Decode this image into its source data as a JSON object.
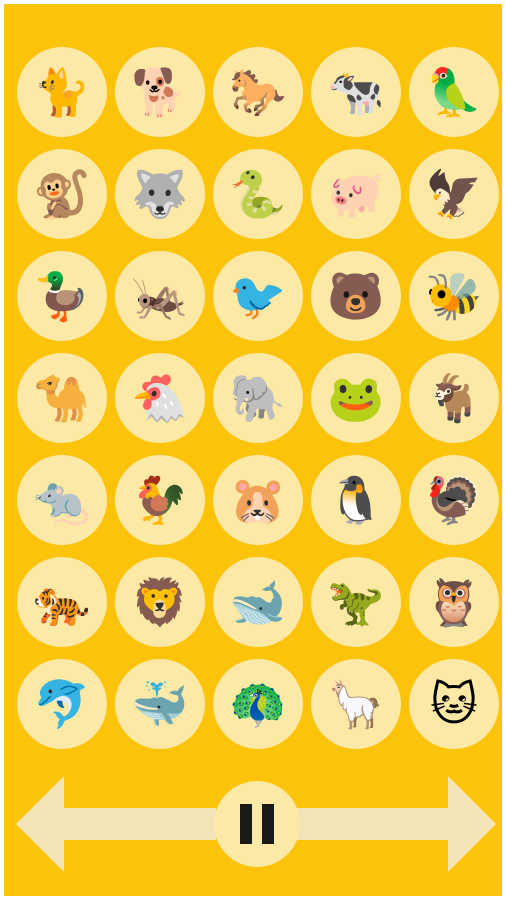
{
  "theme": {
    "background": "#fbc30a",
    "tile": "#fde9a6",
    "arrow": "#f3e4b8",
    "pause_bars": "#1a1a1a"
  },
  "animals": [
    {
      "name": "cat",
      "glyph": "🐈"
    },
    {
      "name": "dog",
      "glyph": "🐕"
    },
    {
      "name": "horse",
      "glyph": "🐎"
    },
    {
      "name": "cow",
      "glyph": "🐄"
    },
    {
      "name": "parrot",
      "glyph": "🦜"
    },
    {
      "name": "monkey",
      "glyph": "🐒"
    },
    {
      "name": "wolf",
      "glyph": "🐺"
    },
    {
      "name": "snake",
      "glyph": "🐍"
    },
    {
      "name": "pig",
      "glyph": "🐖"
    },
    {
      "name": "eagle",
      "glyph": "🦅"
    },
    {
      "name": "duck",
      "glyph": "🦆"
    },
    {
      "name": "cricket",
      "glyph": "🦗"
    },
    {
      "name": "cardinal",
      "glyph": "🐦"
    },
    {
      "name": "bear",
      "glyph": "🐻"
    },
    {
      "name": "bee",
      "glyph": "🐝"
    },
    {
      "name": "camel",
      "glyph": "🐪"
    },
    {
      "name": "chicken",
      "glyph": "🐔"
    },
    {
      "name": "elephant",
      "glyph": "🐘"
    },
    {
      "name": "frog",
      "glyph": "🐸"
    },
    {
      "name": "goat",
      "glyph": "🐐"
    },
    {
      "name": "rat",
      "glyph": "🐀"
    },
    {
      "name": "rooster",
      "glyph": "🐓"
    },
    {
      "name": "hamster",
      "glyph": "🐹"
    },
    {
      "name": "penguin",
      "glyph": "🐧"
    },
    {
      "name": "turkey",
      "glyph": "🦃"
    },
    {
      "name": "tiger",
      "glyph": "🐅"
    },
    {
      "name": "lion",
      "glyph": "🦁"
    },
    {
      "name": "whale",
      "glyph": "🐋"
    },
    {
      "name": "dinosaur",
      "glyph": "🦖"
    },
    {
      "name": "owl",
      "glyph": "🦉"
    },
    {
      "name": "dolphin",
      "glyph": "🐬"
    },
    {
      "name": "spouting-whale",
      "glyph": "🐳"
    },
    {
      "name": "peacock",
      "glyph": "🦚"
    },
    {
      "name": "llama",
      "glyph": "🦙"
    },
    {
      "name": "cat-face",
      "glyph": "🐱"
    }
  ],
  "controls": {
    "prev": "previous-arrow",
    "pause": "pause-icon",
    "next": "next-arrow"
  }
}
